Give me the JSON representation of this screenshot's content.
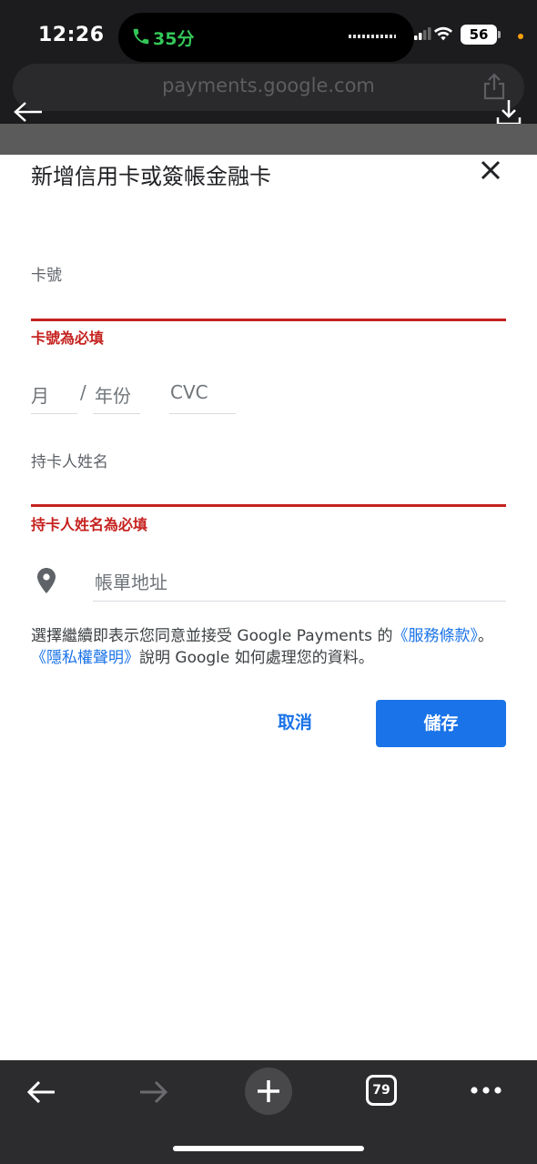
{
  "status_bar": {
    "time": "12:26",
    "call_duration": "35分",
    "battery": "56"
  },
  "browser": {
    "url": "payments.google.com",
    "tab_count": "79"
  },
  "dialog": {
    "title": "新增信用卡或簽帳金融卡",
    "card_number": {
      "label": "卡號",
      "value": "",
      "error": "卡號為必填"
    },
    "expiry": {
      "month_placeholder": "月",
      "separator": "/",
      "year_placeholder": "年份"
    },
    "cvc_placeholder": "CVC",
    "cardholder": {
      "label": "持卡人姓名",
      "value": "",
      "error": "持卡人姓名為必填"
    },
    "billing_address_placeholder": "帳單地址",
    "terms": {
      "prefix": "選擇繼續即表示您同意並接受 Google Payments 的",
      "tos_link": "《服務條款》",
      "middle": "。",
      "privacy_link": "《隱私權聲明》",
      "suffix": "說明 Google 如何處理您的資料。"
    },
    "cancel_label": "取消",
    "save_label": "儲存"
  },
  "colors": {
    "accent": "#1a73e8",
    "error": "#c5221f",
    "call_green": "#34c759"
  }
}
